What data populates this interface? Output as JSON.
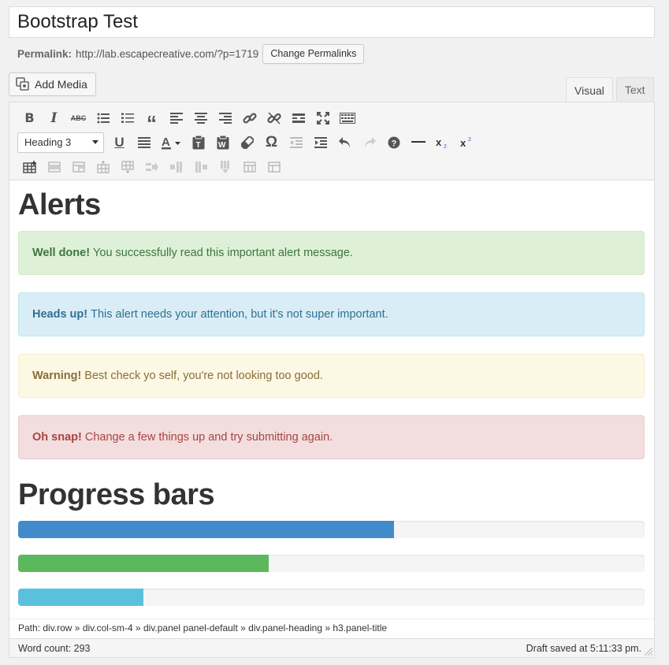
{
  "post": {
    "title": "Bootstrap Test",
    "permalink_label": "Permalink:",
    "permalink_url": "http://lab.escapecreative.com/?p=1719",
    "change_permalinks": "Change Permalinks"
  },
  "media": {
    "add_media": "Add Media"
  },
  "tabs": [
    {
      "label": "Visual",
      "active": true
    },
    {
      "label": "Text",
      "active": false
    }
  ],
  "toolbar": {
    "format_select_value": "Heading 3",
    "row1": [
      "bold-icon",
      "italic-icon",
      "strikethrough-icon",
      "bullet-list-icon",
      "numbered-list-icon",
      "blockquote-icon",
      "align-left-icon",
      "align-center-icon",
      "align-right-icon",
      "insert-link-icon",
      "unlink-icon",
      "read-more-icon",
      "fullscreen-icon",
      "toolbar-toggle-icon"
    ],
    "row2": [
      "underline-icon",
      "justify-icon",
      "text-color-icon",
      "paste-text-icon",
      "paste-word-icon",
      "clear-formatting-icon",
      "special-character-icon",
      "outdent-icon",
      "indent-icon",
      "undo-icon",
      "redo-icon",
      "help-icon",
      "horizontal-line-icon",
      "subscript-icon",
      "superscript-icon"
    ],
    "row3": [
      "table-insert-icon",
      "table-row-props-icon",
      "table-cell-props-icon",
      "row-insert-before-icon",
      "row-insert-after-icon",
      "row-delete-icon",
      "col-insert-before-icon",
      "col-insert-after-icon",
      "col-delete-icon",
      "split-cells-icon",
      "merge-cells-icon"
    ]
  },
  "content": {
    "alerts_heading": "Alerts",
    "alerts": [
      {
        "strong": "Well done!",
        "text": "You successfully read this important alert message.",
        "type": "success"
      },
      {
        "strong": "Heads up!",
        "text": "This alert needs your attention, but it's not super important.",
        "type": "info"
      },
      {
        "strong": "Warning!",
        "text": "Best check yo self, you're not looking too good.",
        "type": "warning"
      },
      {
        "strong": "Oh snap!",
        "text": "Change a few things up and try submitting again.",
        "type": "danger"
      }
    ],
    "progress_heading": "Progress bars",
    "progress_bars": [
      {
        "value": 60,
        "color": "#428bca"
      },
      {
        "value": 40,
        "color": "#5cb85c"
      },
      {
        "value": 20,
        "color": "#5bc0de"
      }
    ]
  },
  "status": {
    "path": "Path: div.row » div.col-sm-4 » div.panel panel-default » div.panel-heading » h3.panel-title",
    "word_count": "Word count: 293",
    "draft_saved": "Draft saved at 5:11:33 pm."
  }
}
